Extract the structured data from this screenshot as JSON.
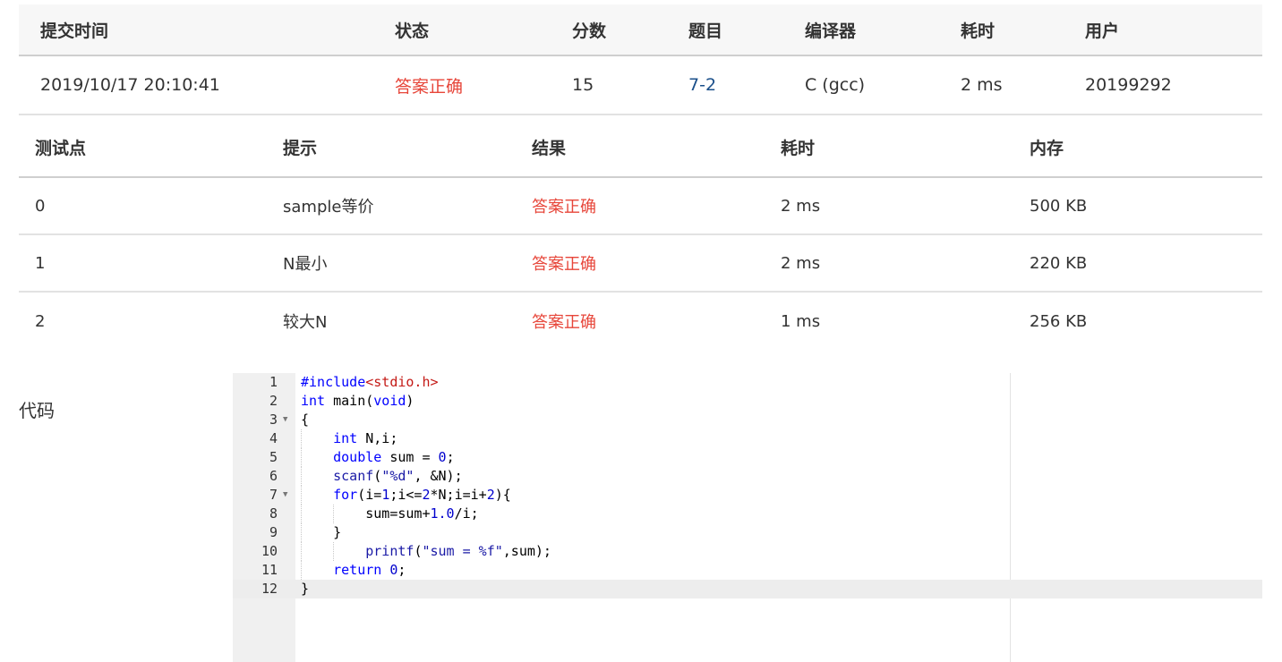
{
  "submission": {
    "headers": [
      "提交时间",
      "状态",
      "分数",
      "题目",
      "编译器",
      "耗时",
      "用户"
    ],
    "row": {
      "time": "2019/10/17 20:10:41",
      "status": "答案正确",
      "score": "15",
      "problem": "7-2",
      "compiler": "C (gcc)",
      "duration": "2 ms",
      "user": "20199292"
    },
    "status_color": "#e7463a",
    "link_color": "#1a4f8a"
  },
  "tests": {
    "headers": [
      "测试点",
      "提示",
      "结果",
      "耗时",
      "内存"
    ],
    "rows": [
      {
        "id": "0",
        "hint": "sample等价",
        "result": "答案正确",
        "time": "2 ms",
        "memory": "500 KB"
      },
      {
        "id": "1",
        "hint": "N最小",
        "result": "答案正确",
        "time": "2 ms",
        "memory": "220 KB"
      },
      {
        "id": "2",
        "hint": "较大N",
        "result": "答案正确",
        "time": "1 ms",
        "memory": "256 KB"
      }
    ]
  },
  "code": {
    "label": "代码",
    "line_numbers": [
      "1",
      "2",
      "3",
      "4",
      "5",
      "6",
      "7",
      "8",
      "9",
      "10",
      "11",
      "12"
    ],
    "fold_markers": [
      "3",
      "7"
    ],
    "lines": [
      "#include<stdio.h>",
      "int main(void)",
      "{",
      "    int N,i;",
      "    double sum = 0;",
      "    scanf(\"%d\", &N);",
      "    for(i=1;i<=2*N;i=i+2){",
      "        sum=sum+1.0/i;",
      "    }",
      "        printf(\"sum = %f\",sum);",
      "    return 0;",
      "}"
    ]
  }
}
